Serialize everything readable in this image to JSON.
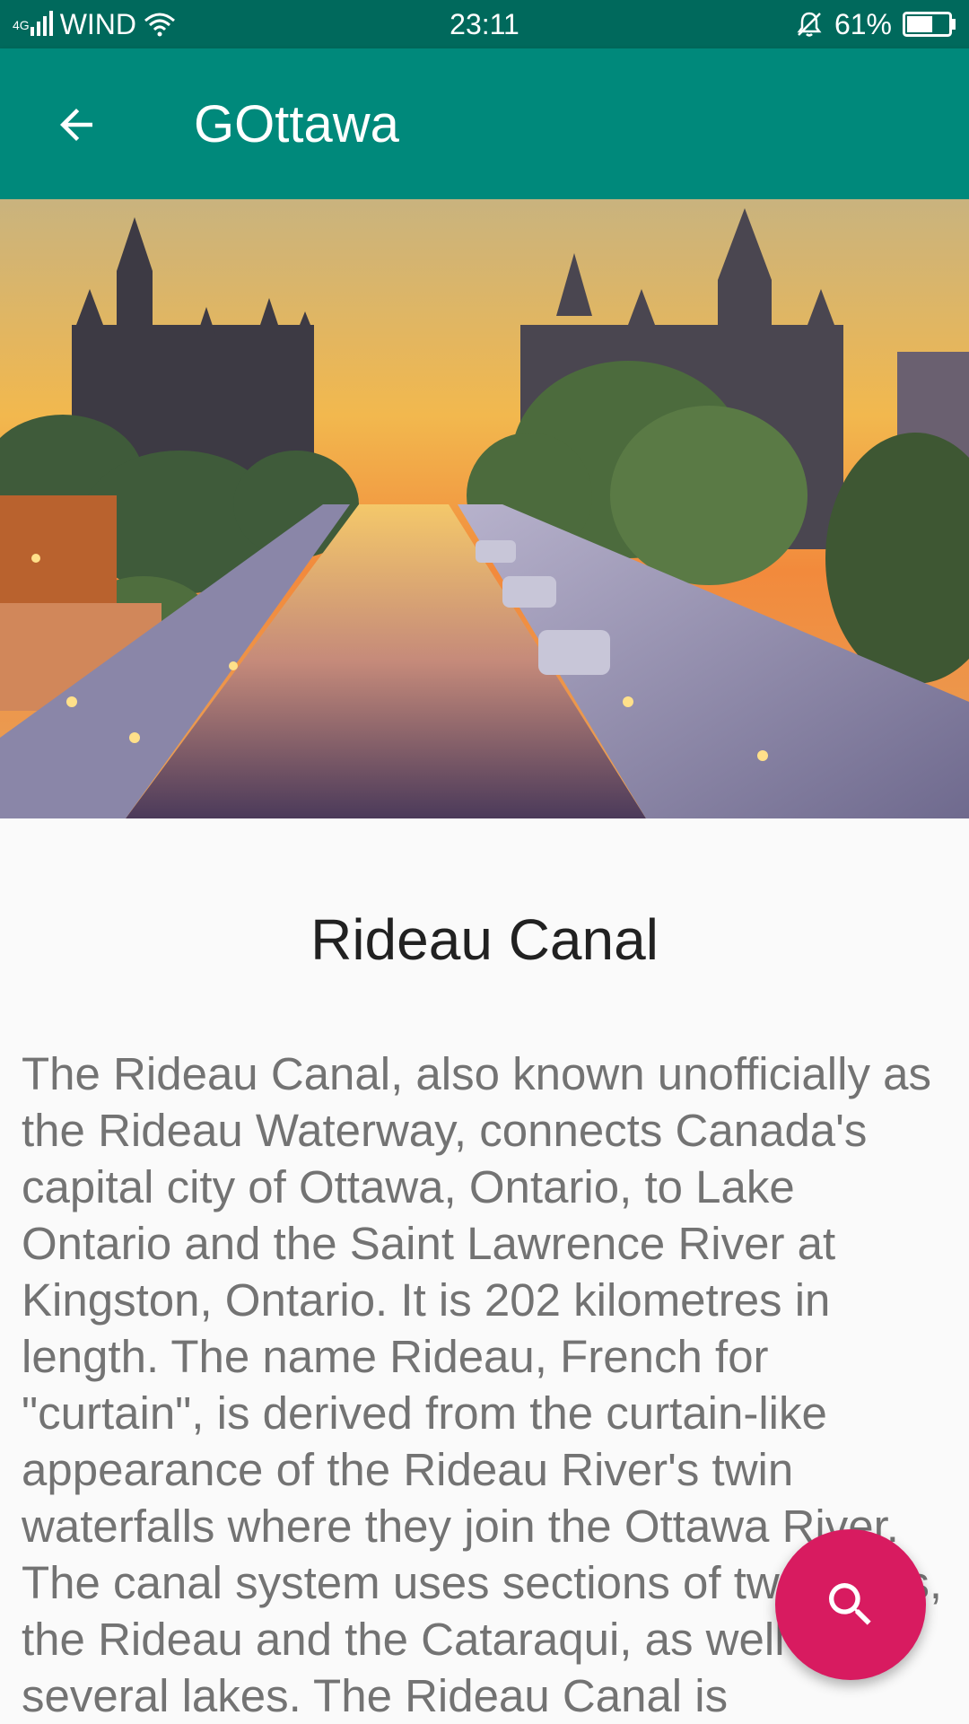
{
  "status_bar": {
    "network_type": "4G",
    "carrier": "WIND",
    "time": "23:11",
    "battery_percent": "61%",
    "battery_level": 0.61,
    "icons": [
      "signal-icon",
      "wifi-icon",
      "bell-muted-icon",
      "battery-icon"
    ]
  },
  "app_bar": {
    "title": "GOttawa",
    "back_icon": "arrow-left-icon",
    "color": "#00897b"
  },
  "hero_image": {
    "subject": "rideau-canal-sunset-photo"
  },
  "detail": {
    "title": "Rideau Canal",
    "description": "The Rideau Canal, also known unofficially as the Rideau Waterway, connects Canada's capital city of Ottawa, Ontario, to Lake Ontario and the Saint Lawrence River at Kingston, Ontario. It is 202 kilometres in length. The name Rideau, French for \"curtain\", is derived from the curtain-like appearance of the Rideau River's twin waterfalls where they join the Ottawa River. The canal system uses sections of two rivers, the Rideau and the Cataraqui, as well as several lakes. The Rideau Canal is"
  },
  "fab": {
    "icon": "search-icon",
    "color": "#d81b60"
  },
  "colors": {
    "status_bar": "#00695c",
    "app_bar": "#00897b",
    "accent": "#d81b60",
    "background": "#fafafa",
    "title_text": "#212121",
    "body_text": "#737373"
  }
}
